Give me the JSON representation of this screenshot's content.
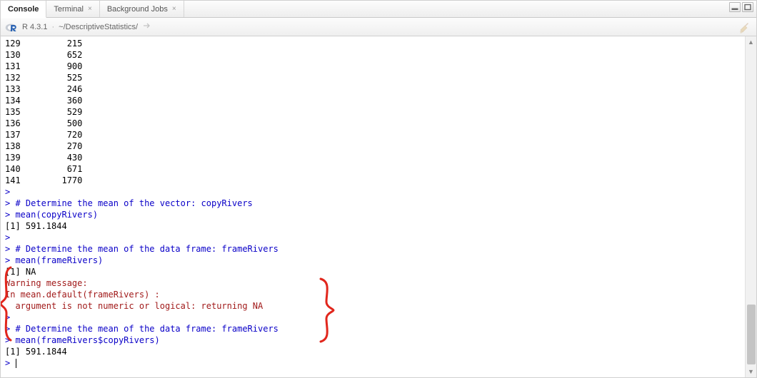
{
  "tabs": {
    "console": "Console",
    "terminal": "Terminal",
    "bgjobs": "Background Jobs"
  },
  "toolbar": {
    "version": "R 4.3.1",
    "dot": "·",
    "path": "~/DescriptiveStatistics/"
  },
  "rows": [
    {
      "idx": "129",
      "val": "215"
    },
    {
      "idx": "130",
      "val": "652"
    },
    {
      "idx": "131",
      "val": "900"
    },
    {
      "idx": "132",
      "val": "525"
    },
    {
      "idx": "133",
      "val": "246"
    },
    {
      "idx": "134",
      "val": "360"
    },
    {
      "idx": "135",
      "val": "529"
    },
    {
      "idx": "136",
      "val": "500"
    },
    {
      "idx": "137",
      "val": "720"
    },
    {
      "idx": "138",
      "val": "270"
    },
    {
      "idx": "139",
      "val": "430"
    },
    {
      "idx": "140",
      "val": "671"
    },
    {
      "idx": "141",
      "val": "1770"
    }
  ],
  "lines": {
    "p1": "> ",
    "c1": "> # Determine the mean of the vector: copyRivers",
    "c2": "> mean(copyRivers)",
    "r1": "[1] 591.1844",
    "p2": "> ",
    "c3": "> # Determine the mean of the data frame: frameRivers",
    "c4": "> mean(frameRivers)",
    "r2": "[1] NA",
    "w1": "Warning message:",
    "w2": "In mean.default(frameRivers) :",
    "w3": "  argument is not numeric or logical: returning NA",
    "p3": "> ",
    "c5": "> # Determine the mean of the data frame: frameRivers",
    "c6": "> mean(frameRivers$copyRivers)",
    "r3": "[1] 591.1844",
    "p4": "> "
  }
}
